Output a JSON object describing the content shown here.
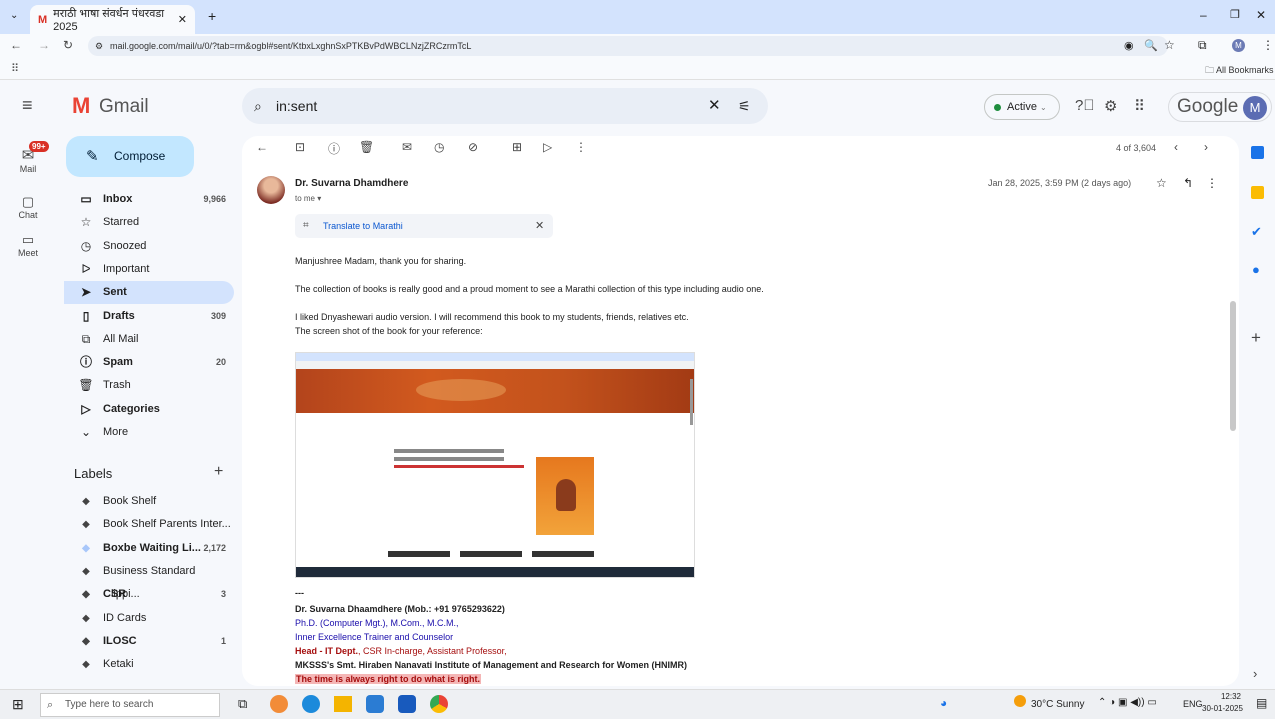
{
  "browser": {
    "tab_title": "मराठी भाषा संवर्धन पंधरवडा 2025",
    "url": "mail.google.com/mail/u/0/?tab=rm&ogbl#sent/KtbxLxghnSxPTKBvPdWBCLNzjZRCzrmTcL",
    "all_bookmarks": "All Bookmarks"
  },
  "header": {
    "app_name": "Gmail",
    "search_value": "in:sent",
    "status": "Active",
    "brand": "Google",
    "avatar": "M"
  },
  "rail": {
    "mail": "Mail",
    "badge": "99+",
    "chat": "Chat",
    "meet": "Meet"
  },
  "sidebar": {
    "compose": "Compose",
    "items": [
      {
        "label": "Inbox",
        "count": "9,966",
        "icon": "inbox-icon",
        "glyph": "▭",
        "bold": true
      },
      {
        "label": "Starred",
        "count": "",
        "icon": "star-icon",
        "glyph": "☆",
        "bold": false
      },
      {
        "label": "Snoozed",
        "count": "",
        "icon": "clock-icon",
        "glyph": "◷",
        "bold": false
      },
      {
        "label": "Important",
        "count": "",
        "icon": "important-icon",
        "glyph": "ᐅ",
        "bold": false
      },
      {
        "label": "Sent",
        "count": "",
        "icon": "send-icon",
        "glyph": "➤",
        "bold": true,
        "selected": true
      },
      {
        "label": "Drafts",
        "count": "309",
        "icon": "draft-icon",
        "glyph": "▯",
        "bold": true
      },
      {
        "label": "All Mail",
        "count": "",
        "icon": "all-mail-icon",
        "glyph": "⧉",
        "bold": false
      },
      {
        "label": "Spam",
        "count": "20",
        "icon": "spam-icon",
        "glyph": "ⓘ",
        "bold": true
      },
      {
        "label": "Trash",
        "count": "",
        "icon": "trash-icon",
        "glyph": "🗑",
        "bold": false
      },
      {
        "label": "Categories",
        "count": "",
        "icon": "label-icon",
        "glyph": "▷",
        "bold": true
      },
      {
        "label": "More",
        "count": "",
        "icon": "chevron-down-icon",
        "glyph": "⌄",
        "bold": false
      }
    ],
    "labels_heading": "Labels",
    "labels": [
      {
        "label": "Book Shelf",
        "count": "",
        "bold": false,
        "color": "#444"
      },
      {
        "label": "Book Shelf Parents Inter...",
        "count": "",
        "bold": false,
        "color": "#444"
      },
      {
        "label": "Boxbe Waiting Li...",
        "count": "2,172",
        "bold": true,
        "color": "#a8c7fa"
      },
      {
        "label": "Business Standard Clippi...",
        "count": "",
        "bold": false,
        "color": "#444"
      },
      {
        "label": "CSR",
        "count": "3",
        "bold": true,
        "color": "#444"
      },
      {
        "label": "ID Cards",
        "count": "",
        "bold": false,
        "color": "#444"
      },
      {
        "label": "ILOSC",
        "count": "1",
        "bold": true,
        "color": "#444"
      },
      {
        "label": "Ketaki",
        "count": "",
        "bold": false,
        "color": "#444"
      }
    ]
  },
  "toolbar": {
    "pager": "4 of 3,604"
  },
  "email": {
    "sender": "Dr. Suvarna Dhamdhere",
    "to": "to me ▾",
    "date": "Jan 28, 2025, 3:59 PM (2 days ago)",
    "translate": "Translate to Marathi",
    "p1": "Manjushree Madam, thank you for sharing.",
    "p2": "The collection of books is really good and a proud moment to see a Marathi collection of this type including audio one.",
    "p3": "I liked Dnyashewari audio version. I will recommend this book to my students, friends, relatives etc.",
    "p4": "The screen shot of the book for your reference:",
    "sig_sep": "---",
    "sig1": "Dr. Suvarna Dhaamdhere (Mob.: +91 9765293622)",
    "sig2": "Ph.D. (Computer Mgt.), M.Com., M.C.M.,",
    "sig3": "Inner Excellence Trainer and Counselor",
    "sig4a": "Head - IT Dept.",
    "sig4b": ", CSR In-charge, Assistant Professor,",
    "sig5": "MKSSS's Smt. Hiraben Nanavati Institute of Management and Research for Women (HNIMR)",
    "sig6": "The time is always right to do what is right."
  },
  "taskbar": {
    "search": "Type here to search",
    "weather": "30°C Sunny",
    "lang": "ENG",
    "time": "12:32",
    "date": "30-01-2025"
  },
  "colors": {
    "accent": "#0b57d0",
    "sig_blue": "#1a0dab",
    "sig_red": "#a50e0e",
    "highlight": "#f4b6b6"
  }
}
